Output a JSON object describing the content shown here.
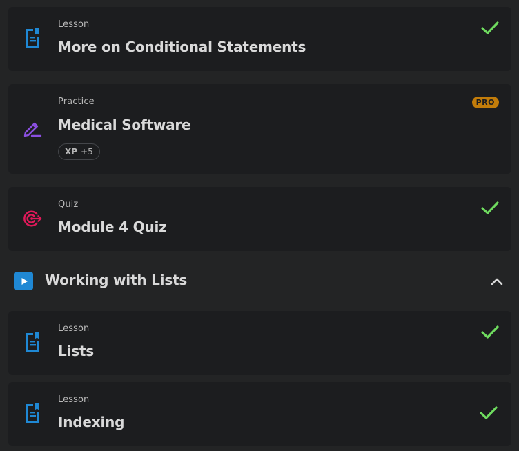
{
  "colors": {
    "background": "#232425",
    "card": "#1c1d1f",
    "lesson_icon": "#1f88d4",
    "practice_icon": "#8b4fe0",
    "quiz_icon": "#e0195a",
    "check": "#6fdc5f",
    "pro_badge": "#c27c0a"
  },
  "items": [
    {
      "type": "Lesson",
      "title": "More on Conditional Statements",
      "icon": "lesson-document-icon",
      "completed": true
    },
    {
      "type": "Practice",
      "title": "Medical Software",
      "icon": "practice-pencil-icon",
      "badge": "PRO",
      "xp_label": "XP",
      "xp_value": "+5",
      "completed": false
    },
    {
      "type": "Quiz",
      "title": "Module 4 Quiz",
      "icon": "quiz-target-icon",
      "completed": true
    }
  ],
  "section": {
    "title": "Working with Lists",
    "icon": "play-icon",
    "expanded": true,
    "items": [
      {
        "type": "Lesson",
        "title": "Lists",
        "icon": "lesson-document-icon",
        "completed": true
      },
      {
        "type": "Lesson",
        "title": "Indexing",
        "icon": "lesson-document-icon",
        "completed": true
      }
    ]
  }
}
